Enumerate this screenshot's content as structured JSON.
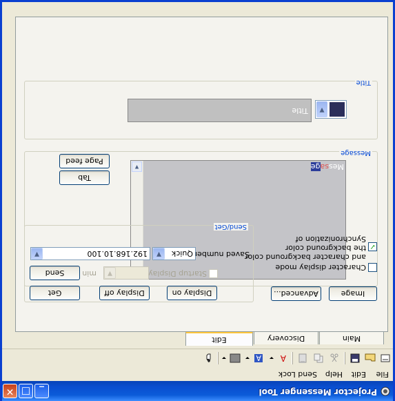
{
  "window": {
    "title": "Projector Messenger Tool",
    "minimize_symbol": "_",
    "maximize_symbol": "□",
    "close_symbol": "✕"
  },
  "menu": [
    "File",
    "Edit",
    "Help",
    "Send Lock"
  ],
  "tabs": [
    "Main",
    "Discovery",
    "Edit"
  ],
  "title_group": {
    "label": "Title",
    "title_text": "Title",
    "color_swatch": "#2b2e5a"
  },
  "message_group": {
    "label": "Message",
    "preview_text_part1": "Mes",
    "preview_text_part2": "sa",
    "preview_text_part3": "ge",
    "tab_button": "Tab",
    "page_feed_button": "Page feed"
  },
  "send_get_group": {
    "label": "Send/Get",
    "display_on_button": "Display on",
    "display_off_button": "Display off",
    "get_button": "Get",
    "startup_display_label": "Startup Display",
    "min_label": "min",
    "send_button": "Send",
    "saved_number_label": "Saved number",
    "saved_number_value": "Quick",
    "ip_value": "192.168.10.100"
  },
  "left_options": {
    "image_button": "Image",
    "advanced_button": "Advanced...",
    "char_display_mode_label": "Character display mode",
    "sync_label_line1": "Synchronization of",
    "sync_label_line2": "the background color",
    "sync_label_line3": "and character background color"
  },
  "colors": {
    "accent": "#0a4ed0",
    "tab_highlight": "#ffc73c",
    "group_label": "#0046d5"
  }
}
